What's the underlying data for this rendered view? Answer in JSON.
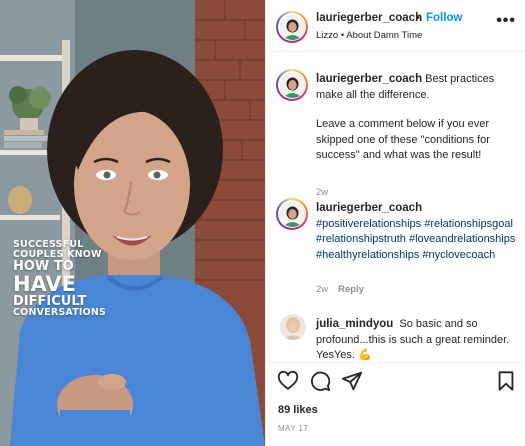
{
  "media": {
    "overlay": {
      "line1": "SUCCESSFUL",
      "line2": "COUPLES KNOW",
      "line3": "HOW TO",
      "line4": "HAVE",
      "line5": "DIFFICULT",
      "line6": "CONVERSATIONS"
    }
  },
  "header": {
    "username": "lauriegerber_coach",
    "separator": "•",
    "follow_label": "Follow",
    "music": "Lizzo • About Damn Time",
    "more_icon": "ellipsis-icon"
  },
  "comments": [
    {
      "username": "lauriegerber_coach",
      "text": "Best practices make all the difference.",
      "text2": "Leave a comment below if you ever skipped one of these \"conditions for success\" and what was the result!",
      "age": "2w"
    },
    {
      "username": "lauriegerber_coach",
      "hashtags": [
        "#positiverelationships",
        "#relationshipsgoal",
        "#relationshipstruth",
        "#loveandrelationships",
        "#healthyrelationships",
        "#nyclovecoach"
      ],
      "age": "2w",
      "reply_label": "Reply"
    },
    {
      "username": "julia_mindyou",
      "text": "So basic and so profound...this is such a great reminder. YesYes.",
      "emoji": "💪"
    }
  ],
  "actions": {
    "like_icon": "heart-icon",
    "comment_icon": "comment-icon",
    "share_icon": "send-icon",
    "save_icon": "bookmark-icon",
    "likes": "89 likes",
    "date": "MAY 17"
  },
  "colors": {
    "accent": "#0095f6",
    "hashtag": "#00376b",
    "muted": "#8e8e8e",
    "sweater": "#4a86d6"
  }
}
